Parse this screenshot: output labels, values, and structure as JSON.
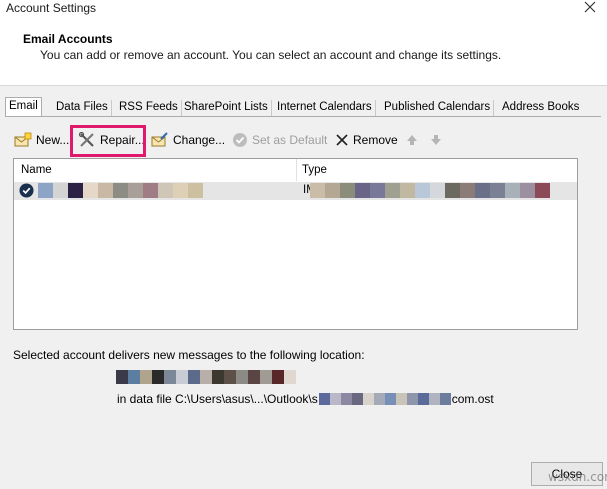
{
  "window": {
    "title": "Account Settings"
  },
  "header": {
    "title": "Email Accounts",
    "description": "You can add or remove an account. You can select an account and change its settings."
  },
  "tabs": [
    {
      "label": "Email",
      "active": true
    },
    {
      "label": "Data Files"
    },
    {
      "label": "RSS Feeds"
    },
    {
      "label": "SharePoint Lists"
    },
    {
      "label": "Internet Calendars"
    },
    {
      "label": "Published Calendars"
    },
    {
      "label": "Address Books"
    }
  ],
  "toolbar": {
    "new_label": "New...",
    "repair_label": "Repair...",
    "change_label": "Change...",
    "set_default_label": "Set as Default",
    "remove_label": "Remove",
    "up_icon": "arrow-up-icon",
    "down_icon": "arrow-down-icon",
    "highlight_color": "#e0196c"
  },
  "accounts_list": {
    "columns": [
      "Name",
      "Type"
    ],
    "rows": [
      {
        "type_prefix": "IM",
        "selected": true,
        "default": true
      }
    ]
  },
  "location": {
    "label": "Selected account delivers new messages to the following location:",
    "line_prefix": "in data file C:\\Users\\asus\\...\\Outlook\\s",
    "line_suffix": "com.ost"
  },
  "footer": {
    "close_label": "Close",
    "watermark": "wsxdn.com"
  }
}
